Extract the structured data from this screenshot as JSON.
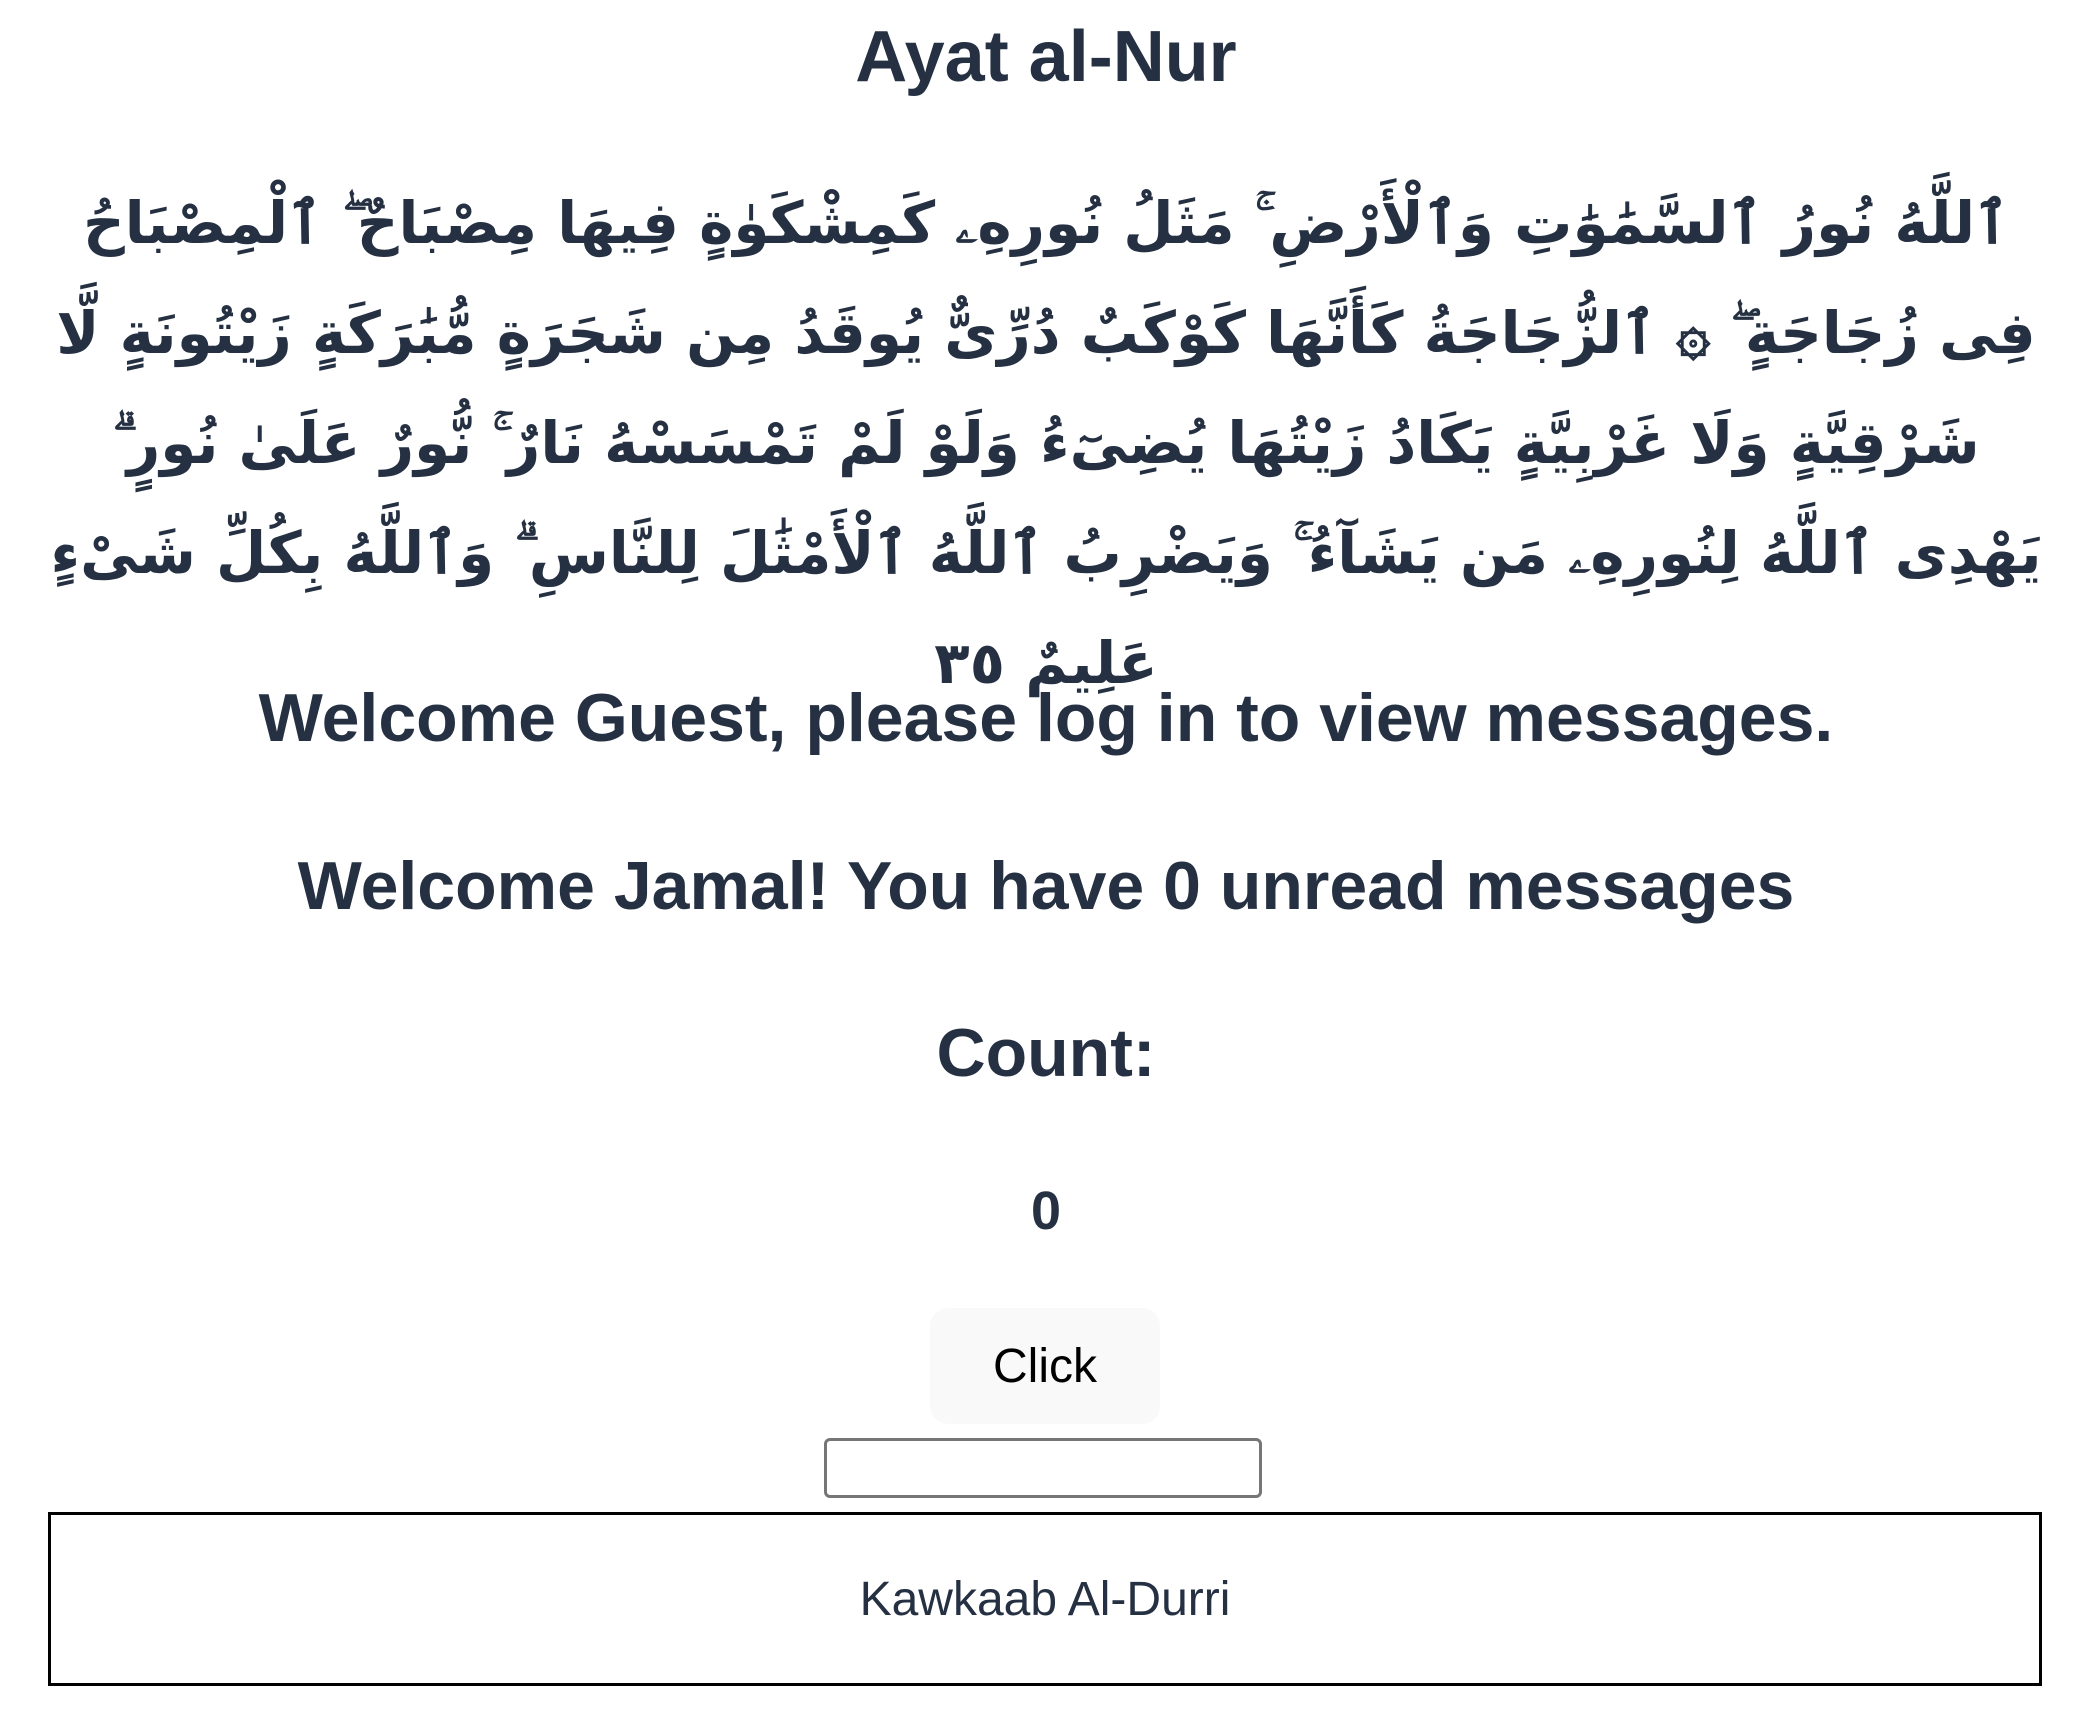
{
  "title": "Ayat al-Nur",
  "ayah_text": "ٱللَّهُ نُورُ ٱلسَّمَٰوَٰتِ وَٱلْأَرْضِ ۚ مَثَلُ نُورِهِۦ كَمِشْكَوٰةٍ فِيهَا مِصْبَاحٌ ۖ ٱلْمِصْبَاحُ فِى زُجَاجَةٍ ۖ ۞ ٱلزُّجَاجَةُ كَأَنَّهَا كَوْكَبٌ دُرِّىٌّ يُوقَدُ مِن شَجَرَةٍ مُّبَٰرَكَةٍ زَيْتُونَةٍ لَّا شَرْقِيَّةٍ وَلَا غَرْبِيَّةٍ يَكَادُ زَيْتُهَا يُضِىٓءُ وَلَوْ لَمْ تَمْسَسْهُ نَارٌ ۚ نُّورٌ عَلَىٰ نُورٍ ۗ يَهْدِى ٱللَّهُ لِنُورِهِۦ مَن يَشَآءُ ۚ وَيَضْرِبُ ٱللَّهُ ٱلْأَمْثَٰلَ لِلنَّاسِ ۗ وَٱللَّهُ بِكُلِّ شَىْءٍ عَلِيمٌ ٣٥",
  "welcome_guest": "Welcome Guest, please log in to view messages.",
  "welcome_user": "Welcome Jamal! You have 0 unread messages",
  "count_label": "Count:",
  "count_value": "0",
  "button_label": "Click",
  "input_value": "",
  "footer_text": "Kawkaab Al-Durri"
}
